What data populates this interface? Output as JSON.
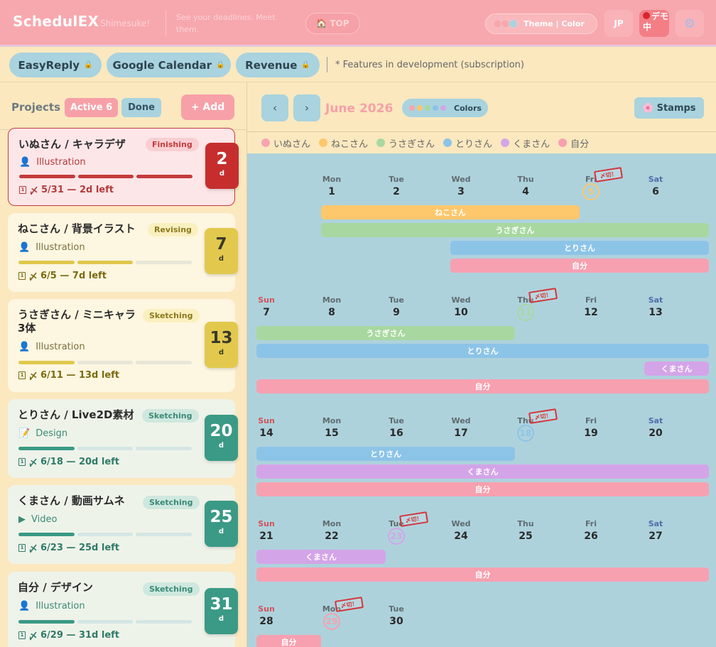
{
  "header": {
    "logo": "SchedulEX",
    "logo_sub": "Shimesuke!",
    "tagline": "See your deadlines. Meet them.",
    "top_label": "TOP",
    "theme_label": "Theme | Color",
    "lang_label": "JP",
    "demo_label": "デモ中"
  },
  "features": {
    "buttons": [
      "EasyReply",
      "Google Calendar",
      "Revenue"
    ],
    "note": "* Features in development (subscription)"
  },
  "projects": {
    "title": "Projects",
    "active_label": "Active 6",
    "done_label": "Done",
    "add_label": "+ Add",
    "cards": [
      {
        "title": "いぬさん / キャラデザ",
        "status": "Finishing",
        "category": "Illustration",
        "icon": "portrait-icon",
        "deadline": "5/31 — 2d left",
        "days": "2",
        "unit": "d",
        "progress": 3
      },
      {
        "title": "ねこさん / 背景イラスト",
        "status": "Revising",
        "category": "Illustration",
        "icon": "portrait-icon",
        "deadline": "6/5 — 7d left",
        "days": "7",
        "unit": "d",
        "progress": 2
      },
      {
        "title": "うさぎさん / ミニキャラ3体",
        "status": "Sketching",
        "category": "Illustration",
        "icon": "portrait-icon",
        "deadline": "6/11 — 13d left",
        "days": "13",
        "unit": "d",
        "progress": 1
      },
      {
        "title": "とりさん / Live2D素材",
        "status": "Sketching",
        "category": "Design",
        "icon": "design-icon",
        "deadline": "6/18 — 20d left",
        "days": "20",
        "unit": "d",
        "progress": 1
      },
      {
        "title": "くまさん / 動画サムネ",
        "status": "Sketching",
        "category": "Video",
        "icon": "video-icon",
        "deadline": "6/23 — 25d left",
        "days": "25",
        "unit": "d",
        "progress": 1
      },
      {
        "title": "自分 / デザイン",
        "status": "Sketching",
        "category": "Illustration",
        "icon": "portrait-icon",
        "deadline": "6/29 — 31d left",
        "days": "31",
        "unit": "d",
        "progress": 1
      }
    ]
  },
  "calendar": {
    "month_title": "June 2026",
    "colors_label": "Colors",
    "stamps_label": "Stamps",
    "stamp_text": "〆切！",
    "legend": [
      {
        "name": "いぬさん",
        "color": "#f7a4b0"
      },
      {
        "name": "ねこさん",
        "color": "#fdc76b"
      },
      {
        "name": "うさぎさん",
        "color": "#a8d8a0"
      },
      {
        "name": "とりさん",
        "color": "#8cc4e8"
      },
      {
        "name": "くまさん",
        "color": "#d4a4e8"
      },
      {
        "name": "自分",
        "color": "#f7a0b0"
      }
    ],
    "weekdays": [
      "Sun",
      "Mon",
      "Tue",
      "Wed",
      "Thu",
      "Fri",
      "Sat"
    ],
    "weeks": [
      {
        "days": [
          "",
          "1",
          "2",
          "3",
          "4",
          "5",
          "6"
        ],
        "deadline_col": 5,
        "deadline_color": "#fdc76b",
        "bars": [
          {
            "label": "ねこさん",
            "start": 1,
            "end": 4,
            "color": "#fdc76b"
          },
          {
            "label": "うさぎさん",
            "start": 1,
            "end": 6,
            "color": "#a8d8a0"
          },
          {
            "label": "とりさん",
            "start": 3,
            "end": 6,
            "color": "#8cc4e8"
          },
          {
            "label": "自分",
            "start": 3,
            "end": 6,
            "color": "#f7a0b0"
          }
        ]
      },
      {
        "days": [
          "7",
          "8",
          "9",
          "10",
          "11",
          "12",
          "13"
        ],
        "deadline_col": 4,
        "deadline_color": "#a8d8a0",
        "bars": [
          {
            "label": "うさぎさん",
            "start": 0,
            "end": 3,
            "color": "#a8d8a0"
          },
          {
            "label": "とりさん",
            "start": 0,
            "end": 6,
            "color": "#8cc4e8"
          },
          {
            "label": "くまさん",
            "start": 6,
            "end": 6,
            "color": "#d4a4e8"
          },
          {
            "label": "自分",
            "start": 0,
            "end": 6,
            "color": "#f7a0b0"
          }
        ]
      },
      {
        "days": [
          "14",
          "15",
          "16",
          "17",
          "18",
          "19",
          "20"
        ],
        "deadline_col": 4,
        "deadline_color": "#8cc4e8",
        "bars": [
          {
            "label": "とりさん",
            "start": 0,
            "end": 3,
            "color": "#8cc4e8"
          },
          {
            "label": "くまさん",
            "start": 0,
            "end": 6,
            "color": "#d4a4e8"
          },
          {
            "label": "自分",
            "start": 0,
            "end": 6,
            "color": "#f7a0b0"
          }
        ]
      },
      {
        "days": [
          "21",
          "22",
          "23",
          "24",
          "25",
          "26",
          "27"
        ],
        "deadline_col": 2,
        "deadline_color": "#d4a4e8",
        "bars": [
          {
            "label": "くまさん",
            "start": 0,
            "end": 1,
            "color": "#d4a4e8"
          },
          {
            "label": "自分",
            "start": 0,
            "end": 6,
            "color": "#f7a0b0"
          }
        ]
      },
      {
        "days": [
          "28",
          "29",
          "30",
          "",
          "",
          "",
          ""
        ],
        "deadline_col": 1,
        "deadline_color": "#f7a0b0",
        "bars": [
          {
            "label": "自分",
            "start": 0,
            "end": 0,
            "color": "#f7a0b0"
          }
        ]
      }
    ]
  }
}
